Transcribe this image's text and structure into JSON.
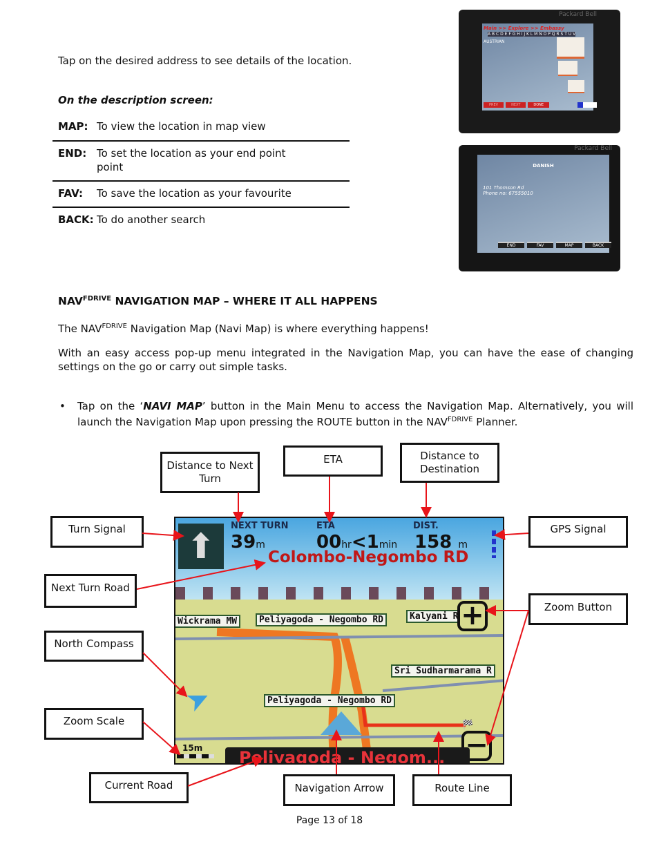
{
  "intro": "Tap on the desired address to see details of the location.",
  "description_heading": "On the description screen:",
  "options": [
    {
      "key": "MAP:",
      "desc": "To view the location in map view"
    },
    {
      "key": "END:",
      "desc": "To set the location as your end point point"
    },
    {
      "key": "FAV:",
      "desc": "To save the location as your favourite"
    },
    {
      "key": "BACK:",
      "desc": "To do another search"
    }
  ],
  "photo1": {
    "brand": "Packard Bell",
    "breadcrumb": "Main >> Explore >> Embassy",
    "letters": "A B C D E F G H I J K L M N O P Q R S T U V",
    "item": "AUSTRIAN",
    "buttons": [
      "PREV",
      "NEXT",
      "DONE"
    ]
  },
  "photo2": {
    "brand": "Packard Bell",
    "title": "DANISH",
    "address": "101 Thomson Rd",
    "phone": "Phone no: 67555010",
    "buttons": [
      "END",
      "FAV",
      "MAP",
      "BACK"
    ]
  },
  "section_title": {
    "pre": "NAV",
    "sup": "FDRIVE",
    "post": " NAVIGATION MAP – WHERE IT ALL HAPPENS"
  },
  "para1": {
    "pre": "The NAV",
    "sup": "FDRIVE",
    "post": " Navigation Map (Navi Map) is where everything happens!"
  },
  "para2": "With an easy access pop-up menu integrated in the Navigation Map, you can have the ease of changing settings on the go or carry out simple tasks.",
  "bullet": {
    "pre": "Tap on the ‘",
    "bold": "NAVI MAP",
    "mid": "’ button in the Main Menu to access the Navigation Map. Alternatively, you will launch the Navigation Map upon pressing the ROUTE button in the NAV",
    "sup": "FDRIVE",
    "post": " Planner."
  },
  "map": {
    "next_turn_label": "NEXT TURN",
    "next_turn_value": "39",
    "next_turn_unit": "m",
    "eta_label": "ETA",
    "eta_hr": "00",
    "eta_hr_unit": "hr",
    "eta_min": "<1",
    "eta_min_unit": "min",
    "dist_label": "DIST.",
    "dist_value": "158",
    "dist_unit": "m",
    "next_road": "Colombo-Negombo RD",
    "roads": [
      "Wickrama MW",
      "Peliyagoda - Negombo RD",
      "Kalyani R",
      "Sri Sudharmarama R",
      "Peliyagoda - Negombo RD"
    ],
    "scale": "15m",
    "current_road": "Peliyagoda - Negom..."
  },
  "callouts": {
    "distance_next_turn": "Distance to Next Turn",
    "eta": "ETA",
    "distance_destination": "Distance to Destination",
    "turn_signal": "Turn Signal",
    "gps_signal": "GPS Signal",
    "next_turn_road": "Next Turn Road",
    "zoom_button": "Zoom Button",
    "north_compass": "North Compass",
    "zoom_scale": "Zoom Scale",
    "current_road": "Current Road",
    "navigation_arrow": "Navigation Arrow",
    "route_line": "Route Line"
  },
  "footer": "Page 13 of 18",
  "colors": {
    "arrow": "#e8141a",
    "route": "#ee7722"
  }
}
